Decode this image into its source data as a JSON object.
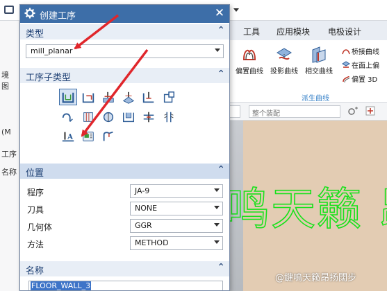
{
  "background": {
    "menu": [
      "工具",
      "应用模块",
      "电极设计"
    ],
    "ribbon_buttons": [
      "偏置曲线",
      "投影曲线",
      "相交曲线"
    ],
    "ribbon_side": [
      "桥接曲线",
      "在面上偏",
      "偏置 3D"
    ],
    "ribbon_group": "派生曲线",
    "left_labels": [
      "境",
      "图",
      "(M",
      "工序",
      "名称"
    ],
    "filter_value": "整个装配",
    "engraved_text": "鸣天籁 昂扬",
    "watermark": "@鍵鳴天籁昂扬闊步"
  },
  "dialog": {
    "title": "创建工序",
    "type_section": {
      "label": "类型",
      "value": "mill_planar"
    },
    "subtype_section": {
      "label": "工序子类型",
      "icons": [
        "floor-wall-icon",
        "floor-wall-ipw-icon",
        "face-milling-icon",
        "face-milling-area-icon",
        "planar-mill-icon",
        "planar-profile-icon",
        "clean-up-corners-icon",
        "finish-walls-icon",
        "finish-floor-icon",
        "groove-milling-icon",
        "hole-milling-icon",
        "thread-milling-icon",
        "planar-text-icon",
        "mill-control-icon",
        "mill-user-icon"
      ],
      "selected_index": 0
    },
    "position_section": {
      "label": "位置",
      "rows": [
        {
          "label": "程序",
          "value": "JA-9"
        },
        {
          "label": "刀具",
          "value": "NONE"
        },
        {
          "label": "几何体",
          "value": "GGR"
        },
        {
          "label": "方法",
          "value": "METHOD"
        }
      ]
    },
    "name_section": {
      "label": "名称",
      "value": "FLOOR_WALL_3"
    }
  },
  "colors": {
    "title_bar": "#3d6ea8",
    "section_header": "#e8eef6",
    "annotation_arrow": "#e0262b",
    "engraved_text": "#19e11c"
  }
}
